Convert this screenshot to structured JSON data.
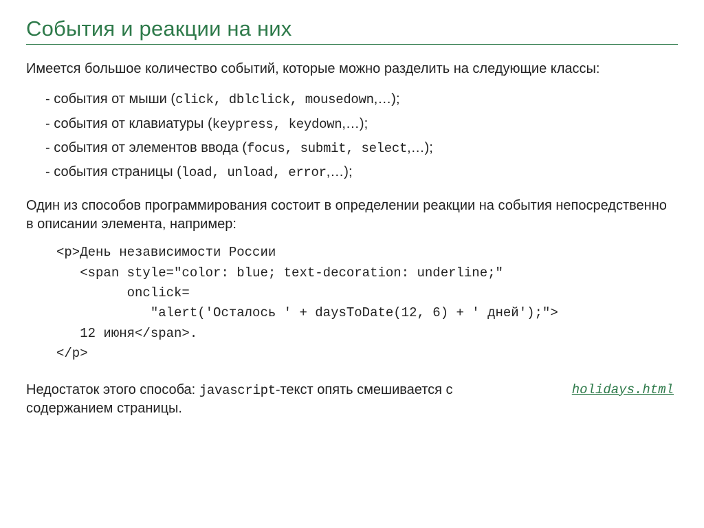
{
  "title": "События и реакции на них",
  "intro": "Имеется большое количество событий, которые можно разделить на следующие классы:",
  "bullets": {
    "b0": {
      "prefix": "- события от мыши (",
      "events": "click, dblclick, mousedown",
      "suffix": ",…);"
    },
    "b1": {
      "prefix": "- события от клавиатуры (",
      "events": "keypress, keydown",
      "suffix": ",…);"
    },
    "b2": {
      "prefix": "- события от элементов ввода (",
      "events": "focus, submit, select",
      "suffix": ",…);"
    },
    "b3": {
      "prefix": "- события страницы (",
      "events": "load, unload, error",
      "suffix": ",…);"
    }
  },
  "method_para": "Один из способов программирования состоит в определении реакции на события непосредственно в описании элемента, например:",
  "code": "<p>День независимости России\n   <span style=\"color: blue; text-decoration: underline;\"\n         onclick=\n            \"alert('Осталось ' + daysToDate(12, 6) + ' дней');\">\n   12 июня</span>.\n</p>",
  "caveat_pre": "Недостаток этого способа: ",
  "caveat_mono": "javascript",
  "caveat_post": "-текст опять смешивается с содержанием страницы.",
  "link": "holidays.html"
}
